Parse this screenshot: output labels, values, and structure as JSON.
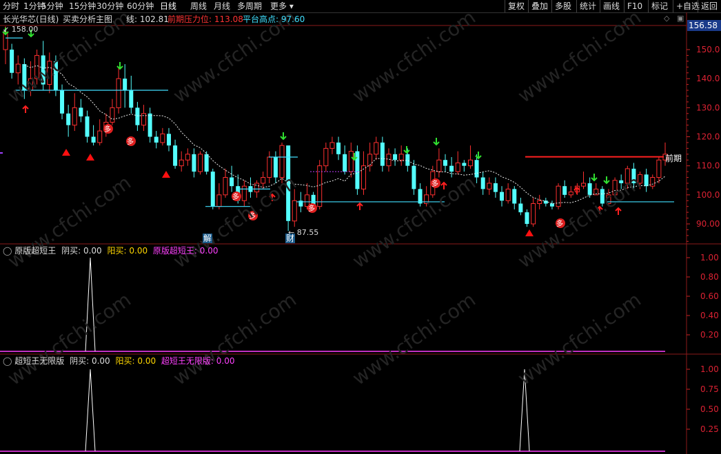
{
  "toolbar": {
    "periods": [
      "分时",
      "1分钟",
      "5分钟",
      "15分钟",
      "30分钟",
      "60分钟",
      "日线",
      "周线",
      "月线",
      "多周期",
      "更多"
    ],
    "active_period": "日线",
    "right_buttons": [
      "复权",
      "叠加",
      "多股",
      "统计",
      "画线",
      "F10",
      "标记",
      "+自选",
      "返回"
    ]
  },
  "main_panel": {
    "stock": "长光华芯(日线)",
    "indicator_name": "买卖分析主图",
    "line_label": "线: 102.81",
    "pressure_label": "前期压力位: 113.08",
    "platform_label": "平台高点: 97.60",
    "high_price_label": "158.00",
    "low_price_label": "87.55",
    "right_price_label": "前期",
    "current_price": "156.58",
    "y_ticks": [
      "150.0",
      "140.0",
      "130.0",
      "120.0",
      "110.0",
      "100.0",
      "90.00"
    ],
    "markers": {
      "jie": "解",
      "cai": "财",
      "duo": "多"
    }
  },
  "indicator1": {
    "name": "原版超短王",
    "yin_label": "阴买: 0.00",
    "yang_label": "阳买: 0.00",
    "value_label": "原版超短王: 0.00",
    "y_ticks": [
      "1.00",
      "0.80",
      "0.60",
      "0.40",
      "0.20"
    ]
  },
  "indicator2": {
    "name": "超短王无限版",
    "yin_label": "阴买: 0.00",
    "yang_label": "阳买: 0.00",
    "value_label": "超短王无限版: 0.00",
    "y_ticks": [
      "1.00",
      "0.75",
      "0.50",
      "0.25"
    ]
  },
  "watermark": "www.cfchi.com",
  "chart_data": {
    "type": "candlestick",
    "y_range": [
      85,
      160
    ],
    "candles": [
      {
        "o": 150,
        "c": 156,
        "h": 158,
        "l": 145
      },
      {
        "o": 150,
        "c": 142,
        "h": 152,
        "l": 140
      },
      {
        "o": 142,
        "c": 145,
        "h": 148,
        "l": 138
      },
      {
        "o": 145,
        "c": 136,
        "h": 147,
        "l": 133
      },
      {
        "o": 136,
        "c": 140,
        "h": 146,
        "l": 134
      },
      {
        "o": 140,
        "c": 148,
        "h": 150,
        "l": 138
      },
      {
        "o": 148,
        "c": 138,
        "h": 153,
        "l": 136
      },
      {
        "o": 138,
        "c": 146,
        "h": 149,
        "l": 135
      },
      {
        "o": 146,
        "c": 136,
        "h": 148,
        "l": 134
      },
      {
        "o": 136,
        "c": 128,
        "h": 138,
        "l": 126
      },
      {
        "o": 128,
        "c": 124,
        "h": 131,
        "l": 120
      },
      {
        "o": 124,
        "c": 130,
        "h": 135,
        "l": 122
      },
      {
        "o": 130,
        "c": 127,
        "h": 133,
        "l": 125
      },
      {
        "o": 127,
        "c": 120,
        "h": 129,
        "l": 118
      },
      {
        "o": 120,
        "c": 118,
        "h": 124,
        "l": 117
      },
      {
        "o": 118,
        "c": 122,
        "h": 126,
        "l": 117
      },
      {
        "o": 122,
        "c": 125,
        "h": 128,
        "l": 120
      },
      {
        "o": 125,
        "c": 130,
        "h": 133,
        "l": 124
      },
      {
        "o": 130,
        "c": 140,
        "h": 144,
        "l": 128
      },
      {
        "o": 140,
        "c": 136,
        "h": 145,
        "l": 130
      },
      {
        "o": 136,
        "c": 130,
        "h": 141,
        "l": 128
      },
      {
        "o": 130,
        "c": 124,
        "h": 132,
        "l": 122
      },
      {
        "o": 124,
        "c": 128,
        "h": 131,
        "l": 122
      },
      {
        "o": 128,
        "c": 120,
        "h": 130,
        "l": 118
      },
      {
        "o": 120,
        "c": 118,
        "h": 122,
        "l": 116
      },
      {
        "o": 118,
        "c": 121,
        "h": 123,
        "l": 117
      },
      {
        "o": 121,
        "c": 117,
        "h": 123,
        "l": 115
      },
      {
        "o": 117,
        "c": 110,
        "h": 119,
        "l": 109
      },
      {
        "o": 110,
        "c": 112,
        "h": 115,
        "l": 108
      },
      {
        "o": 112,
        "c": 114,
        "h": 116,
        "l": 110
      },
      {
        "o": 114,
        "c": 108,
        "h": 116,
        "l": 106
      },
      {
        "o": 108,
        "c": 114,
        "h": 115,
        "l": 107
      },
      {
        "o": 114,
        "c": 108,
        "h": 115,
        "l": 107
      },
      {
        "o": 108,
        "c": 96,
        "h": 109,
        "l": 95
      },
      {
        "o": 96,
        "c": 100,
        "h": 104,
        "l": 95
      },
      {
        "o": 100,
        "c": 106,
        "h": 109,
        "l": 99
      },
      {
        "o": 106,
        "c": 103,
        "h": 110,
        "l": 101
      },
      {
        "o": 103,
        "c": 98,
        "h": 107,
        "l": 97
      },
      {
        "o": 98,
        "c": 103,
        "h": 105,
        "l": 96
      },
      {
        "o": 103,
        "c": 101,
        "h": 106,
        "l": 99
      },
      {
        "o": 101,
        "c": 104,
        "h": 105,
        "l": 99
      },
      {
        "o": 104,
        "c": 106,
        "h": 108,
        "l": 102
      },
      {
        "o": 106,
        "c": 113,
        "h": 115,
        "l": 104
      },
      {
        "o": 113,
        "c": 106,
        "h": 115,
        "l": 104
      },
      {
        "o": 106,
        "c": 117,
        "h": 118,
        "l": 104
      },
      {
        "o": 117,
        "c": 91,
        "h": 100,
        "l": 87.55
      },
      {
        "o": 91,
        "c": 98,
        "h": 102,
        "l": 89
      },
      {
        "o": 98,
        "c": 96,
        "h": 101,
        "l": 94
      },
      {
        "o": 96,
        "c": 100,
        "h": 104,
        "l": 95
      },
      {
        "o": 100,
        "c": 96,
        "h": 101,
        "l": 94
      },
      {
        "o": 96,
        "c": 110,
        "h": 112,
        "l": 95
      },
      {
        "o": 110,
        "c": 116,
        "h": 118,
        "l": 108
      },
      {
        "o": 116,
        "c": 118,
        "h": 120,
        "l": 114
      },
      {
        "o": 118,
        "c": 114,
        "h": 120,
        "l": 112
      },
      {
        "o": 114,
        "c": 108,
        "h": 117,
        "l": 107
      },
      {
        "o": 108,
        "c": 115,
        "h": 118,
        "l": 106
      },
      {
        "o": 115,
        "c": 102,
        "h": 117,
        "l": 100
      },
      {
        "o": 102,
        "c": 110,
        "h": 115,
        "l": 100
      },
      {
        "o": 110,
        "c": 114,
        "h": 118,
        "l": 108
      },
      {
        "o": 114,
        "c": 118,
        "h": 120,
        "l": 112
      },
      {
        "o": 118,
        "c": 110,
        "h": 120,
        "l": 108
      },
      {
        "o": 110,
        "c": 114,
        "h": 116,
        "l": 108
      },
      {
        "o": 114,
        "c": 112,
        "h": 116,
        "l": 110
      },
      {
        "o": 112,
        "c": 114,
        "h": 117,
        "l": 110
      },
      {
        "o": 114,
        "c": 110,
        "h": 116,
        "l": 108
      },
      {
        "o": 110,
        "c": 102,
        "h": 112,
        "l": 100
      },
      {
        "o": 102,
        "c": 97,
        "h": 104,
        "l": 96
      },
      {
        "o": 97,
        "c": 100,
        "h": 103,
        "l": 96
      },
      {
        "o": 100,
        "c": 108,
        "h": 110,
        "l": 99
      },
      {
        "o": 108,
        "c": 112,
        "h": 116,
        "l": 106
      },
      {
        "o": 112,
        "c": 110,
        "h": 114,
        "l": 108
      },
      {
        "o": 110,
        "c": 108,
        "h": 113,
        "l": 106
      },
      {
        "o": 108,
        "c": 111,
        "h": 115,
        "l": 107
      },
      {
        "o": 111,
        "c": 110,
        "h": 112,
        "l": 108
      },
      {
        "o": 110,
        "c": 112,
        "h": 117,
        "l": 109
      },
      {
        "o": 112,
        "c": 106,
        "h": 114,
        "l": 104
      },
      {
        "o": 106,
        "c": 102,
        "h": 108,
        "l": 100
      },
      {
        "o": 102,
        "c": 104,
        "h": 106,
        "l": 100
      },
      {
        "o": 104,
        "c": 101,
        "h": 106,
        "l": 99
      },
      {
        "o": 101,
        "c": 98,
        "h": 103,
        "l": 96
      },
      {
        "o": 98,
        "c": 102,
        "h": 104,
        "l": 97
      },
      {
        "o": 102,
        "c": 97,
        "h": 103,
        "l": 95
      },
      {
        "o": 97,
        "c": 94,
        "h": 99,
        "l": 93
      },
      {
        "o": 94,
        "c": 90,
        "h": 95,
        "l": 89
      },
      {
        "o": 90,
        "c": 97,
        "h": 99,
        "l": 89
      },
      {
        "o": 97,
        "c": 98,
        "h": 100,
        "l": 95
      },
      {
        "o": 98,
        "c": 97,
        "h": 99,
        "l": 96
      },
      {
        "o": 97,
        "c": 96,
        "h": 98,
        "l": 95
      },
      {
        "o": 96,
        "c": 103,
        "h": 104,
        "l": 95
      },
      {
        "o": 103,
        "c": 100,
        "h": 105,
        "l": 99
      },
      {
        "o": 100,
        "c": 101,
        "h": 103,
        "l": 99
      },
      {
        "o": 101,
        "c": 103,
        "h": 104,
        "l": 100
      },
      {
        "o": 103,
        "c": 104,
        "h": 108,
        "l": 102
      },
      {
        "o": 104,
        "c": 100,
        "h": 106,
        "l": 99
      },
      {
        "o": 100,
        "c": 102,
        "h": 104,
        "l": 100
      },
      {
        "o": 102,
        "c": 97,
        "h": 103,
        "l": 96
      },
      {
        "o": 97,
        "c": 100,
        "h": 102,
        "l": 96
      },
      {
        "o": 100,
        "c": 105,
        "h": 106,
        "l": 99
      },
      {
        "o": 105,
        "c": 104,
        "h": 107,
        "l": 102
      },
      {
        "o": 104,
        "c": 109,
        "h": 110,
        "l": 102
      },
      {
        "o": 109,
        "c": 104,
        "h": 111,
        "l": 102
      },
      {
        "o": 104,
        "c": 107,
        "h": 108,
        "l": 102
      },
      {
        "o": 107,
        "c": 103,
        "h": 109,
        "l": 101
      },
      {
        "o": 103,
        "c": 106,
        "h": 107,
        "l": 102
      },
      {
        "o": 106,
        "c": 112,
        "h": 113,
        "l": 104
      },
      {
        "o": 112,
        "c": 114,
        "h": 118,
        "l": 110
      }
    ]
  }
}
